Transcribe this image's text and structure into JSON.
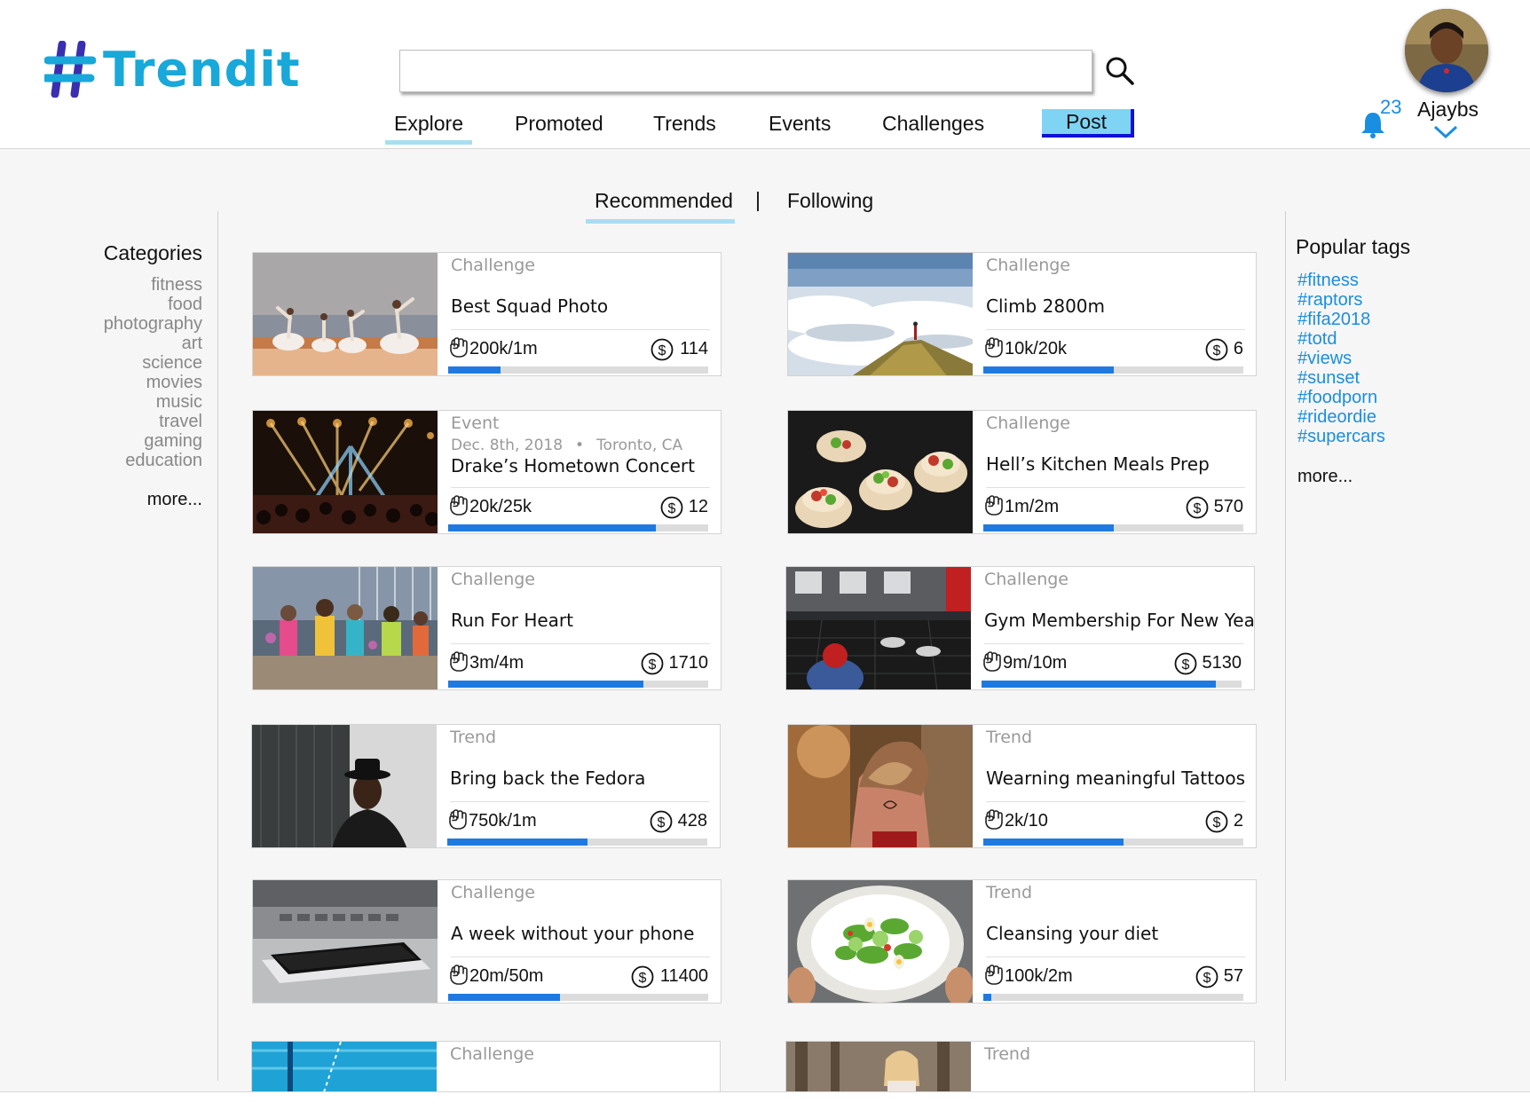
{
  "app": {
    "name": "Trendit"
  },
  "header": {
    "search": {
      "value": "",
      "placeholder": ""
    },
    "nav": [
      {
        "label": "Explore",
        "active": true
      },
      {
        "label": "Promoted",
        "active": false
      },
      {
        "label": "Trends",
        "active": false
      },
      {
        "label": "Events",
        "active": false
      },
      {
        "label": "Challenges",
        "active": false
      }
    ],
    "post_label": "Post",
    "user": {
      "name": "Ajaybs",
      "notifications": "23"
    }
  },
  "feed_tabs": {
    "recommended": "Recommended",
    "separator": "|",
    "following": "Following",
    "active": "recommended"
  },
  "categories": {
    "title": "Categories",
    "items": [
      "fitness",
      "food",
      "photography",
      "art",
      "science",
      "movies",
      "music",
      "travel",
      "gaming",
      "education"
    ],
    "more": "more..."
  },
  "popular_tags": {
    "title": "Popular tags",
    "items": [
      "#fitness",
      "#raptors",
      "#fifa2018",
      "#totd",
      "#views",
      "#sunset",
      "#foodporn",
      "#rideordie",
      "#supercars"
    ],
    "more": "more..."
  },
  "cards": [
    {
      "type": "Challenge",
      "title": "Best Squad Photo",
      "count": "200k/1m",
      "reward": "114",
      "progress": 0.2,
      "image": "dancers"
    },
    {
      "type": "Challenge",
      "title": "Climb 2800m",
      "count": "10k/20k",
      "reward": "6",
      "progress": 0.5,
      "image": "mountain"
    },
    {
      "type": "Event",
      "date": "Dec. 8th, 2018",
      "location": "Toronto, CA",
      "title": "Drake’s Hometown Concert",
      "count": "20k/25k",
      "reward": "12",
      "progress": 0.8,
      "image": "concert"
    },
    {
      "type": "Challenge",
      "title": "Hell’s Kitchen Meals Prep",
      "count": "1m/2m",
      "reward": "570",
      "progress": 0.5,
      "image": "wraps"
    },
    {
      "type": "Challenge",
      "title": "Run For Heart",
      "count": "3m/4m",
      "reward": "1710",
      "progress": 0.75,
      "image": "runners"
    },
    {
      "type": "Challenge",
      "title": "Gym Membership For New Years",
      "count": "9m/10m",
      "reward": "5130",
      "progress": 0.9,
      "image": "gym"
    },
    {
      "type": "Trend",
      "title": "Bring back the Fedora",
      "count": "750k/1m",
      "reward": "428",
      "progress": 0.54,
      "image": "fedora"
    },
    {
      "type": "Trend",
      "title": "Wearning meaningful Tattoos",
      "count": "2k/10",
      "reward": "2",
      "progress": 0.54,
      "image": "tattoo"
    },
    {
      "type": "Challenge",
      "title": "A week without your phone",
      "count": "20m/50m",
      "reward": "11400",
      "progress": 0.43,
      "image": "phone"
    },
    {
      "type": "Trend",
      "title": "Cleansing your diet",
      "count": "100k/2m",
      "reward": "57",
      "progress": 0.03,
      "image": "salad"
    },
    {
      "type": "Challenge",
      "title": "",
      "count": "",
      "reward": "",
      "progress": 0,
      "image": "pool"
    },
    {
      "type": "Trend",
      "title": "",
      "count": "",
      "reward": "",
      "progress": 0,
      "image": "forest"
    }
  ],
  "colors": {
    "brand": "#18a8d9",
    "accent": "#1f7ae0",
    "tag": "#1a8ee0",
    "post_button": "#7fd4f3",
    "post_border": "#1010d8",
    "active_underline": "#a9def0"
  },
  "icons": {
    "search": "search-icon",
    "bell": "bell-icon",
    "chevron": "chevron-down-icon",
    "fist": "fist-icon",
    "coin": "dollar-coin-icon"
  }
}
